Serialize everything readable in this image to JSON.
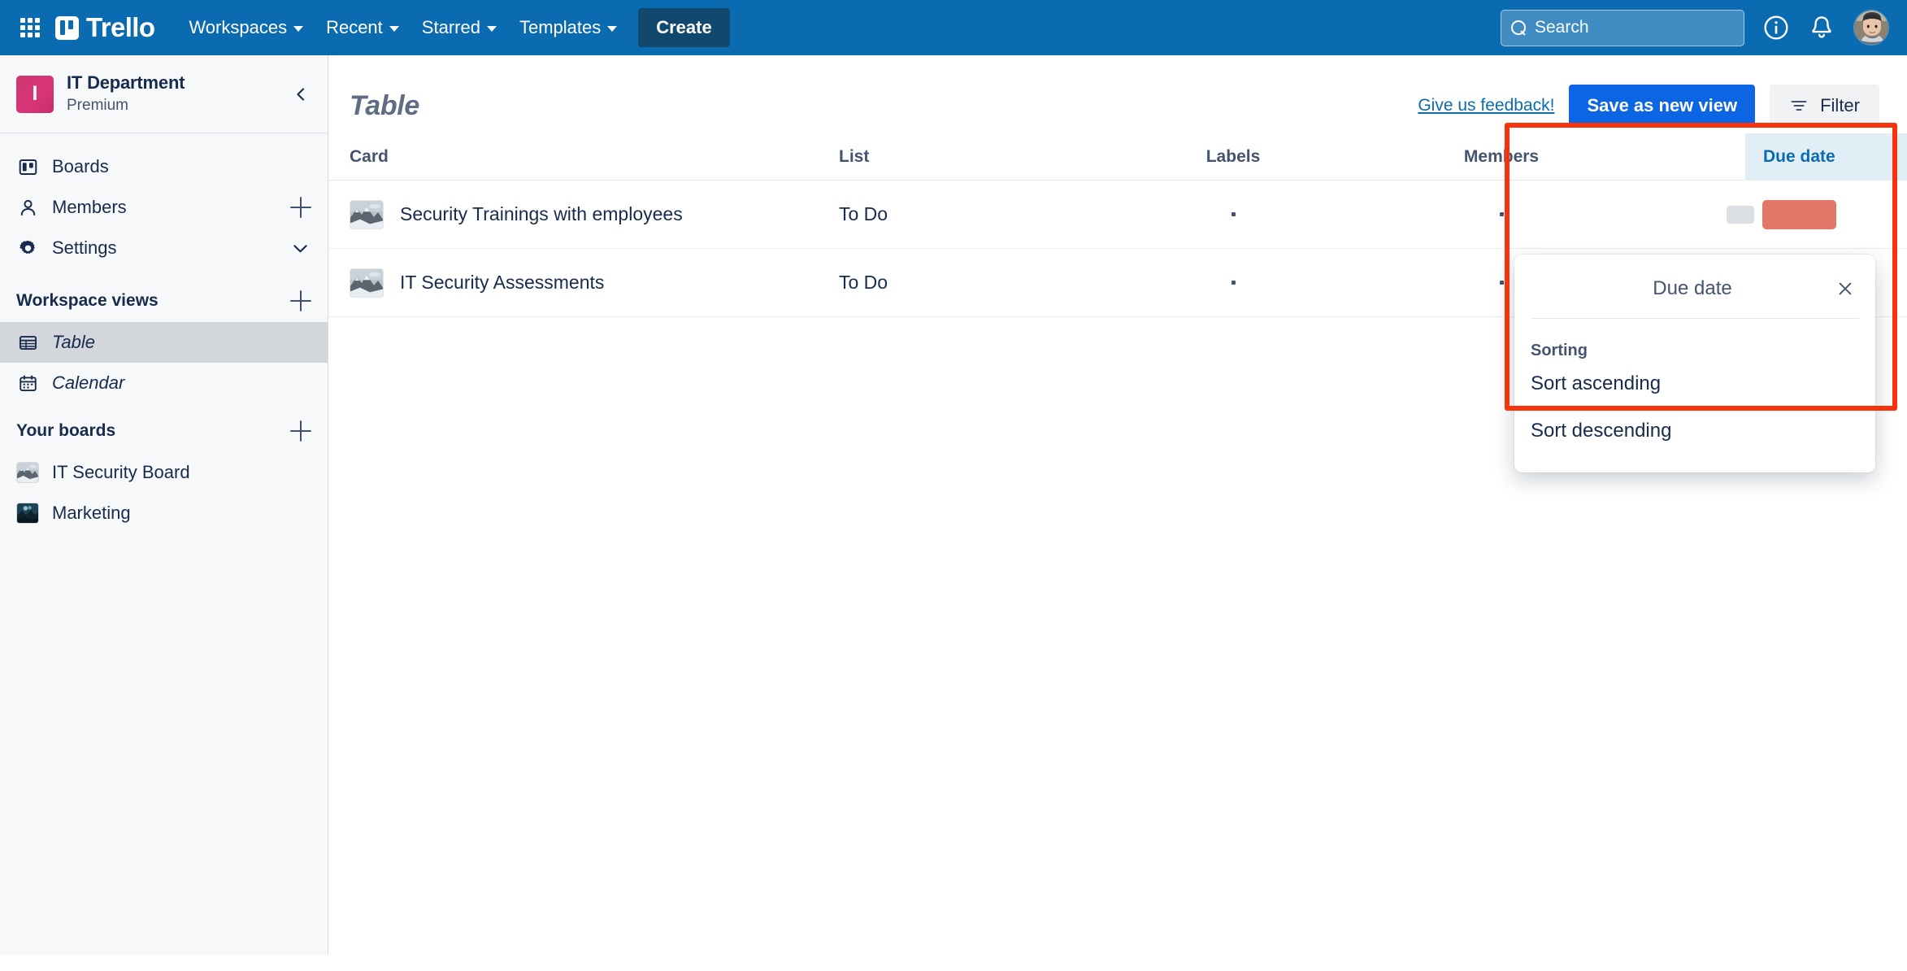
{
  "topnav": {
    "apps_icon": "grid-apps-icon",
    "logo_text": "Trello",
    "menus": [
      {
        "label": "Workspaces"
      },
      {
        "label": "Recent"
      },
      {
        "label": "Starred"
      },
      {
        "label": "Templates"
      }
    ],
    "create_label": "Create",
    "search_placeholder": "Search",
    "info_icon": "info-circle-icon",
    "notifications_icon": "bell-icon",
    "avatar": "user-avatar"
  },
  "sidebar": {
    "workspace": {
      "initial": "I",
      "name": "IT Department",
      "plan": "Premium",
      "collapse_icon": "chevron-left-icon"
    },
    "nav": [
      {
        "label": "Boards",
        "icon": "boards-icon",
        "trailing": "none"
      },
      {
        "label": "Members",
        "icon": "person-icon",
        "trailing": "plus"
      },
      {
        "label": "Settings",
        "icon": "gear-icon",
        "trailing": "chevron-down"
      }
    ],
    "views_section": {
      "title": "Workspace views",
      "trailing": "plus"
    },
    "views": [
      {
        "label": "Table",
        "icon": "table-icon",
        "active": true
      },
      {
        "label": "Calendar",
        "icon": "calendar-icon",
        "active": false
      }
    ],
    "boards_section": {
      "title": "Your boards",
      "trailing": "plus"
    },
    "boards": [
      {
        "label": "IT Security Board",
        "thumb": "mountain"
      },
      {
        "label": "Marketing",
        "thumb": "night"
      }
    ]
  },
  "main": {
    "title": "Table",
    "feedback_link": "Give us feedback!",
    "save_view_label": "Save as new view",
    "filter_label": "Filter",
    "filter_icon": "filter-icon",
    "table": {
      "columns": [
        "Card",
        "List",
        "Labels",
        "Members",
        "Due date"
      ],
      "due_date_header": {
        "label": "Due date",
        "active": true,
        "chevron_icon": "chevron-down-icon",
        "bg_color": "#e1eef5",
        "text_color": "#0b6bb0"
      },
      "rows": [
        {
          "card": "Security Trainings with employees",
          "list": "To Do",
          "labels": "·",
          "members": "·",
          "thumb": "mountain",
          "due_badge_color": "#e2776a"
        },
        {
          "card": "IT Security Assessments",
          "list": "To Do",
          "labels": "·",
          "members": "·",
          "thumb": "mountain",
          "due_badge_color": "#e2776a"
        }
      ]
    }
  },
  "popup": {
    "title": "Due date",
    "close_icon": "close-x-icon",
    "section_label": "Sorting",
    "items": [
      {
        "label": "Sort ascending"
      },
      {
        "label": "Sort descending"
      }
    ]
  },
  "highlight": {
    "color": "#f6330c"
  }
}
